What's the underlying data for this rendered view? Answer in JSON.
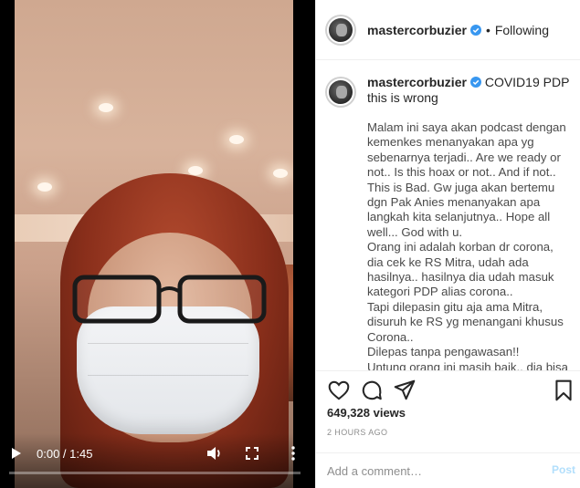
{
  "video": {
    "current_time": "0:00",
    "duration": "1:45",
    "time_separator": " / ",
    "progress_fraction": 0.0,
    "icons": [
      "play-icon",
      "volume-icon",
      "fullscreen-icon",
      "more-vertical-icon"
    ]
  },
  "header": {
    "username": "mastercorbuzier",
    "separator": "•",
    "follow_status": "Following"
  },
  "caption": {
    "username": "mastercorbuzier",
    "headline": "COVID19 PDP this is wrong",
    "body": "Malam ini saya akan podcast dengan kemenkes menanyakan apa yg sebenarnya terjadi.. Are we ready or not.. Is this hoax or not.. And if not.. This is Bad. Gw juga akan bertemu dgn Pak Anies menanyakan apa langkah kita selanjutnya.. Hope all well... God with u.\nOrang ini adalah korban dr corona, dia cek ke RS Mitra, udah ada hasilnya.. hasilnya dia udah masuk kategori PDP alias corona..\nTapi dilepasin gitu aja ama Mitra, disuruh ke RS yg menangani khusus Corona..\nDilepas tanpa pengawasan!!\nUntung orang ini masih baik.. dia bisa"
  },
  "stats": {
    "views": "649,328 views",
    "posted_ago": "2 HOURS AGO"
  },
  "comment": {
    "placeholder": "Add a comment…",
    "post_label": "Post"
  },
  "colors": {
    "verified_blue": "#3897f0",
    "post_disabled": "#b2dffc",
    "muted_gray": "#8e8e8e"
  }
}
